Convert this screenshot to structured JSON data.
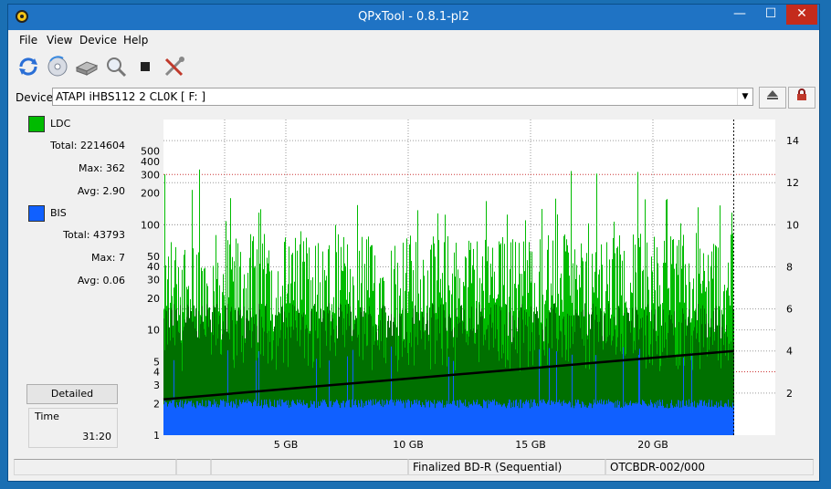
{
  "window": {
    "title": "QPxTool - 0.8.1-pl2",
    "controls": {
      "minimize": "—",
      "maximize": "☐",
      "close": "✕"
    }
  },
  "menu": [
    "File",
    "View",
    "Device",
    "Help"
  ],
  "toolbar": {
    "icons": [
      "refresh-icon",
      "disc-scan-icon",
      "drive-icon",
      "magnifier-icon",
      "stop-icon",
      "tools-icon"
    ]
  },
  "device": {
    "label": "Device:",
    "value": "ATAPI   iHBS112   2     CL0K [ F: ]",
    "eject_icon": "eject-icon",
    "lock_icon": "lock-icon"
  },
  "legend": {
    "ldc": {
      "label": "LDC",
      "color": "#00bb00",
      "total": "Total: 2214604",
      "max": "Max: 362",
      "avg": "Avg: 2.90"
    },
    "bis": {
      "label": "BIS",
      "color": "#1060ff",
      "total": "Total: 43793",
      "max": "Max: 7",
      "avg": "Avg: 0.06"
    }
  },
  "detailed_button": "Detailed",
  "time": {
    "label": "Time",
    "value": "31:20"
  },
  "status": {
    "cells": [
      "",
      "",
      "",
      "Finalized BD-R (Sequential)",
      "OTCBDR-002/000"
    ]
  },
  "chart_data": {
    "type": "bar",
    "x_ticks": [
      "5 GB",
      "10 GB",
      "15 GB",
      "20 GB"
    ],
    "x_tick_values": [
      5,
      10,
      15,
      20
    ],
    "xlim": [
      0,
      25
    ],
    "data_end_gb": 23.3,
    "y_left_ticks": [
      "1",
      "2",
      "3",
      "4",
      "5",
      "10",
      "20",
      "30",
      "40",
      "50",
      "100",
      "200",
      "300",
      "400",
      "500"
    ],
    "y_left_values": [
      1,
      2,
      3,
      4,
      5,
      10,
      20,
      30,
      40,
      50,
      100,
      200,
      300,
      400,
      500
    ],
    "y_left_scale": "log",
    "ylim_left": [
      1,
      1000
    ],
    "y_right_ticks": [
      "2",
      "4",
      "6",
      "8",
      "10",
      "12",
      "14"
    ],
    "y_right_values": [
      2,
      4,
      6,
      8,
      10,
      12,
      14
    ],
    "ylim_right": [
      0,
      15
    ],
    "series": [
      {
        "name": "LDC",
        "color": "#00bb00",
        "approx_typical": 25,
        "approx_peaks": [
          300,
          360
        ]
      },
      {
        "name": "BIS",
        "color": "#1060ff",
        "approx_typical": 2,
        "approx_peaks": [
          5,
          7
        ]
      },
      {
        "name": "",
        "color": "#000000",
        "kind": "line",
        "x": [
          0,
          23.3
        ],
        "y_right": [
          1.7,
          4.0
        ]
      }
    ],
    "grid": true,
    "colors": {
      "background": "#ffffff",
      "grid": "#9a9a9a",
      "red_grid": "#cc3333"
    }
  }
}
